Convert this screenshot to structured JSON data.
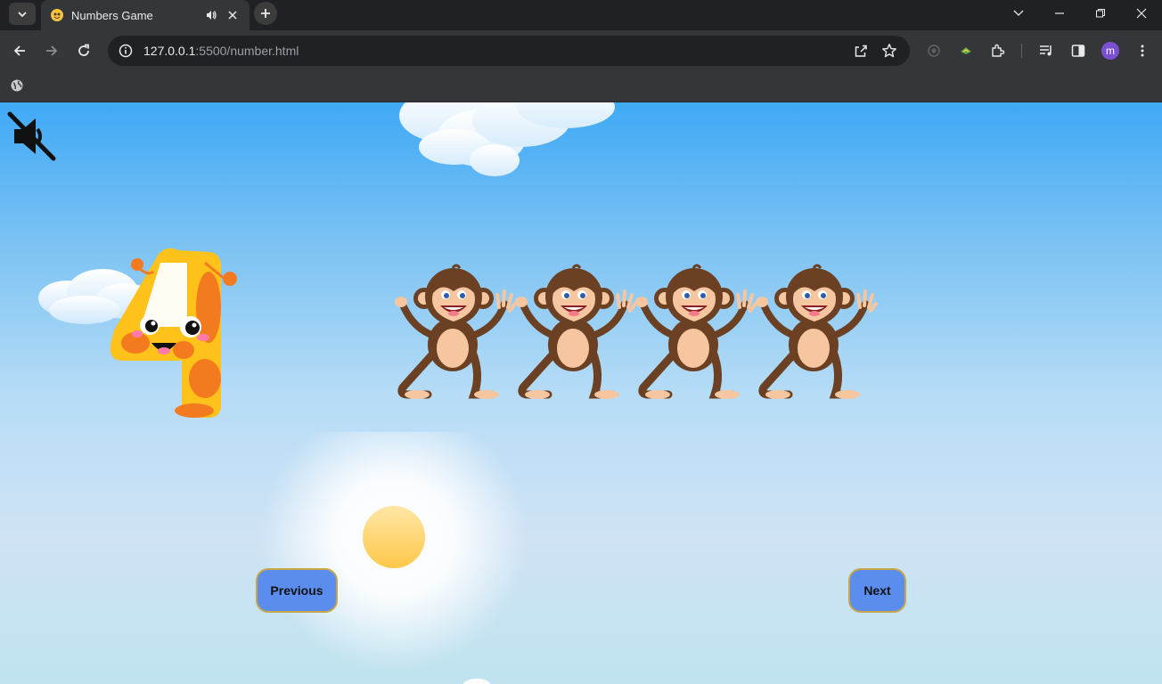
{
  "browser": {
    "tab_title": "Numbers Game",
    "url_host": "127.0.0.1",
    "url_path": ":5500/number.html",
    "avatar_letter": "m"
  },
  "game": {
    "current_number": 4,
    "objects": "monkey",
    "object_count": 4,
    "sound_muted": true,
    "previous_label": "Previous",
    "next_label": "Next"
  },
  "colors": {
    "button_bg": "#5b8def",
    "button_border": "#c7a64a",
    "sky_top": "#3fa9f5",
    "sky_bottom": "#bfe3ef"
  },
  "icons": {
    "mute": "speaker-muted-icon",
    "back": "arrow-left-icon",
    "forward": "arrow-right-icon",
    "reload": "reload-icon",
    "site_info": "info-icon",
    "share": "share-icon",
    "bookmark": "star-icon",
    "extensions": "puzzle-icon"
  }
}
